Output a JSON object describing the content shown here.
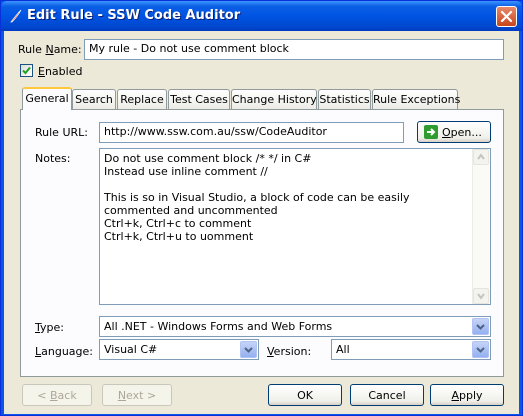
{
  "window": {
    "title": "Edit Rule - SSW Code Auditor"
  },
  "rule_name": {
    "label_prefix": "Rule ",
    "label_accel": "N",
    "label_rest": "ame:",
    "value": "My rule - Do not use comment block"
  },
  "enabled": {
    "accel": "E",
    "rest": "nabled",
    "checked": true
  },
  "tabs": [
    "General",
    "Search",
    "Replace",
    "Test Cases",
    "Change History",
    "Statistics",
    "Rule Exceptions"
  ],
  "general": {
    "rule_url_label": "Rule URL:",
    "rule_url_value": "http://www.ssw.com.au/ssw/CodeAuditor",
    "open_button": {
      "accel": "O",
      "rest": "pen..."
    },
    "notes_label": "Notes:",
    "notes_text": "Do not use comment block /* */ in C#\nInstead use inline comment //\n\nThis is so in Visual Studio, a block of code can be easily commented and uncommented\nCtrl+k, Ctrl+c to comment\nCtrl+k, Ctrl+u to uomment"
  },
  "type": {
    "accel": "T",
    "rest": "ype:",
    "value": "All .NET - Windows Forms and Web Forms"
  },
  "language": {
    "accel": "L",
    "rest": "anguage:",
    "value": "Visual C#"
  },
  "version": {
    "accel": "V",
    "rest": "ersion:",
    "value": "All"
  },
  "buttons": {
    "back": {
      "prefix": "< ",
      "accel": "B",
      "rest": "ack"
    },
    "next": {
      "prefix": "",
      "accel": "N",
      "rest": "ext >"
    },
    "ok": "OK",
    "cancel": "Cancel",
    "apply_accel": "A",
    "apply_rest": "pply"
  },
  "colors": {
    "titlebar": "#0054e3",
    "dialog": "#ece9d8",
    "tab_highlight": "#ffc83c",
    "open_arrow": "#2e9c2e"
  }
}
